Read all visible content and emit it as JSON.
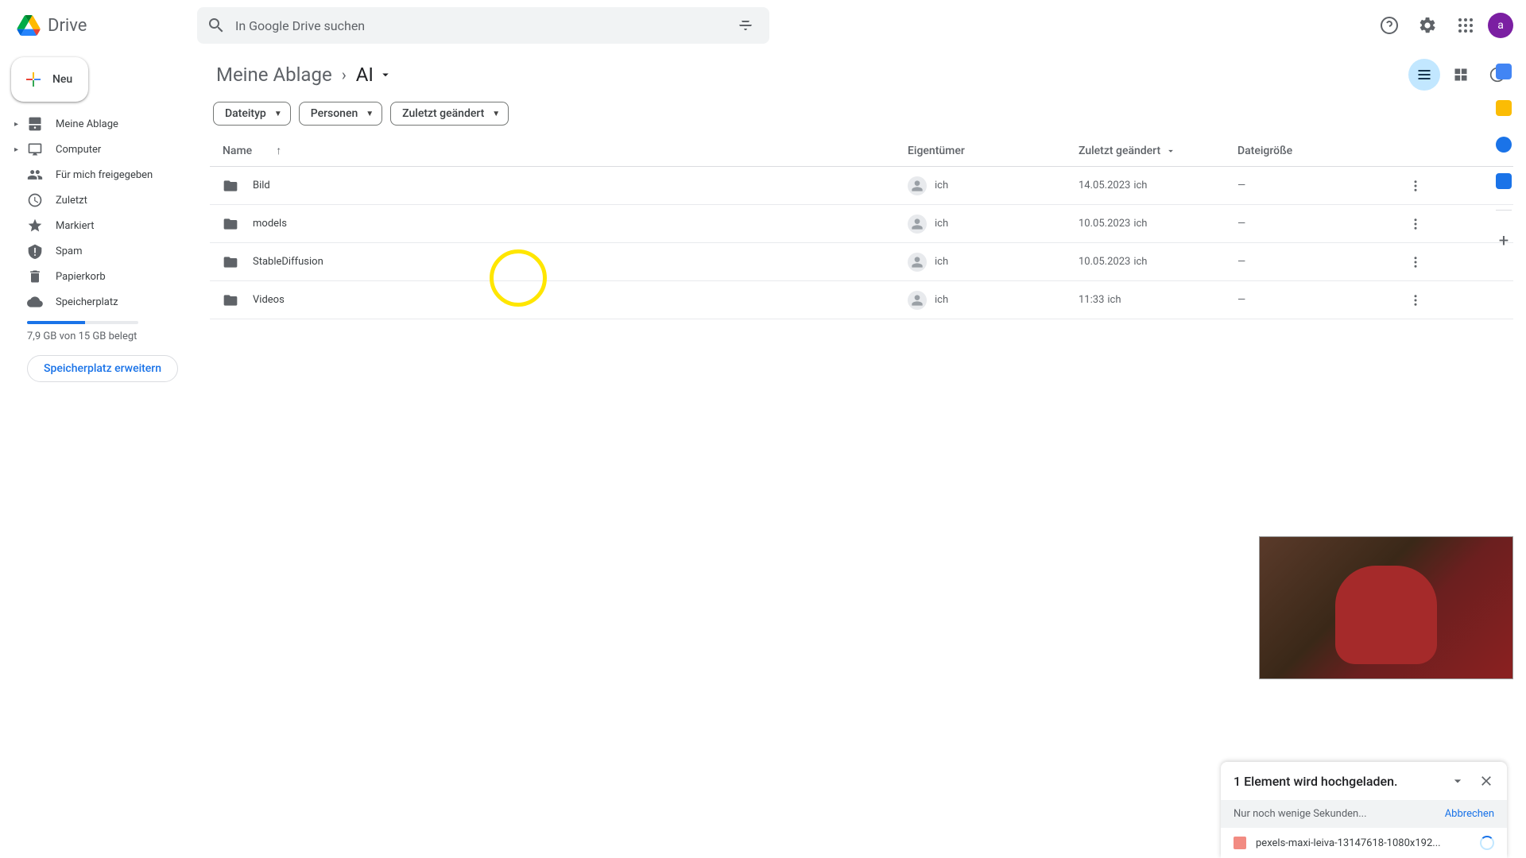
{
  "header": {
    "app_name": "Drive",
    "search_placeholder": "In Google Drive suchen",
    "avatar_letter": "a"
  },
  "sidebar": {
    "new_label": "Neu",
    "items": [
      {
        "label": "Meine Ablage"
      },
      {
        "label": "Computer"
      },
      {
        "label": "Für mich freigegeben"
      },
      {
        "label": "Zuletzt"
      },
      {
        "label": "Markiert"
      },
      {
        "label": "Spam"
      },
      {
        "label": "Papierkorb"
      },
      {
        "label": "Speicherplatz"
      }
    ],
    "storage_text": "7,9 GB von 15 GB belegt",
    "storage_button": "Speicherplatz erweitern"
  },
  "breadcrumb": {
    "root": "Meine Ablage",
    "current": "AI"
  },
  "filters": {
    "type": "Dateityp",
    "people": "Personen",
    "modified": "Zuletzt geändert"
  },
  "columns": {
    "name": "Name",
    "owner": "Eigentümer",
    "modified": "Zuletzt geändert",
    "size": "Dateigröße"
  },
  "rows": [
    {
      "name": "Bild",
      "owner": "ich",
      "date": "14.05.2023",
      "by": "ich",
      "size": "—"
    },
    {
      "name": "models",
      "owner": "ich",
      "date": "10.05.2023",
      "by": "ich",
      "size": "—"
    },
    {
      "name": "StableDiffusion",
      "owner": "ich",
      "date": "10.05.2023",
      "by": "ich",
      "size": "—"
    },
    {
      "name": "Videos",
      "owner": "ich",
      "date": "11:33",
      "by": "ich",
      "size": "—"
    }
  ],
  "upload": {
    "title": "1 Element wird hochgeladen.",
    "subtitle": "Nur noch wenige Sekunden...",
    "cancel": "Abbrechen",
    "filename": "pexels-maxi-leiva-13147618-1080x192..."
  }
}
